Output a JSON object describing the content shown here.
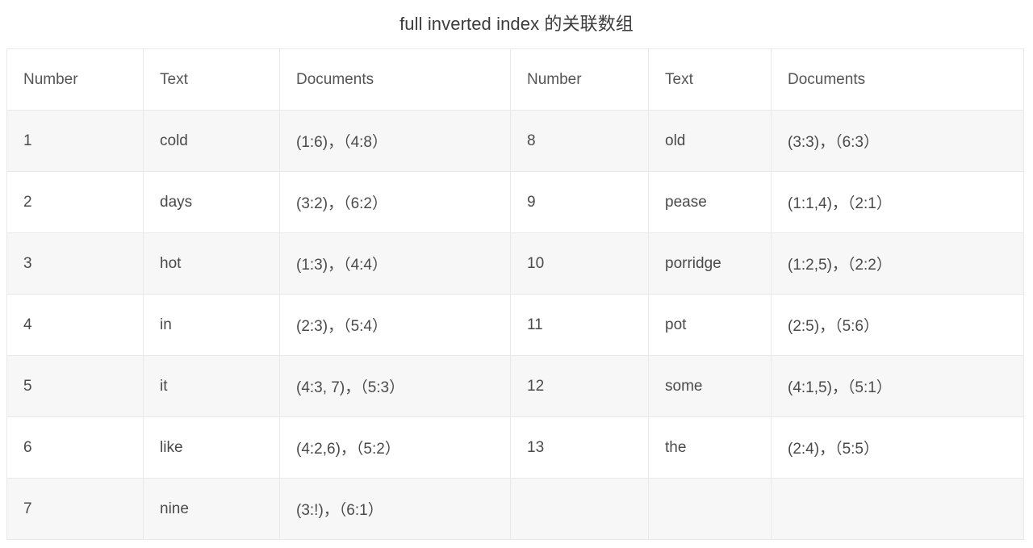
{
  "title": "full inverted index 的关联数组",
  "table": {
    "headers": {
      "left": {
        "number": "Number",
        "text": "Text",
        "documents": "Documents"
      },
      "right": {
        "number": "Number",
        "text": "Text",
        "documents": "Documents"
      }
    },
    "rows": [
      {
        "left": {
          "number": "1",
          "text": "cold",
          "documents": "(1:6)，（4:8）"
        },
        "right": {
          "number": "8",
          "text": "old",
          "documents": "(3:3)，（6:3）"
        }
      },
      {
        "left": {
          "number": "2",
          "text": "days",
          "documents": "(3:2)，（6:2）"
        },
        "right": {
          "number": "9",
          "text": "pease",
          "documents": "(1:1,4)，（2:1）"
        }
      },
      {
        "left": {
          "number": "3",
          "text": "hot",
          "documents": "(1:3)，（4:4）"
        },
        "right": {
          "number": "10",
          "text": "porridge",
          "documents": "(1:2,5)，（2:2）"
        }
      },
      {
        "left": {
          "number": "4",
          "text": "in",
          "documents": "(2:3)，（5:4）"
        },
        "right": {
          "number": "11",
          "text": "pot",
          "documents": "(2:5)，（5:6）"
        }
      },
      {
        "left": {
          "number": "5",
          "text": "it",
          "documents": "(4:3, 7)，（5:3）"
        },
        "right": {
          "number": "12",
          "text": "some",
          "documents": "(4:1,5)，（5:1）"
        }
      },
      {
        "left": {
          "number": "6",
          "text": "like",
          "documents": "(4:2,6)，（5:2）"
        },
        "right": {
          "number": "13",
          "text": "the",
          "documents": "(2:4)，（5:5）"
        }
      },
      {
        "left": {
          "number": "7",
          "text": "nine",
          "documents": "(3:!)，（6:1）"
        },
        "right": {
          "number": "",
          "text": "",
          "documents": ""
        }
      }
    ]
  },
  "colors": {
    "border": "#e9e9e9",
    "stripe": "#f7f7f7",
    "text": "#4a4a4a",
    "background": "#ffffff"
  }
}
